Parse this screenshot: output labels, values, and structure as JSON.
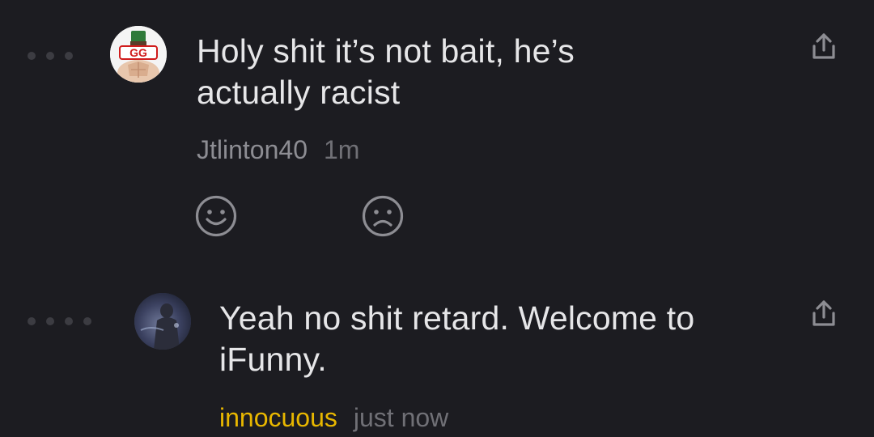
{
  "comments": [
    {
      "text": "Holy shit it’s not bait, he’s actually racist",
      "author": "Jtlinton40",
      "time": "1m",
      "avatar_badge": "GG"
    },
    {
      "text": "Yeah no shit retard. Welcome to iFunny.",
      "author": "innocuous",
      "time": "just now"
    }
  ],
  "colors": {
    "background": "#1c1c21",
    "text": "#e6e6e8",
    "meta": "#8d8d93",
    "highlight_author": "#e8b700"
  },
  "icons": [
    "thread-dots",
    "share-icon",
    "smile-icon",
    "frown-icon"
  ]
}
